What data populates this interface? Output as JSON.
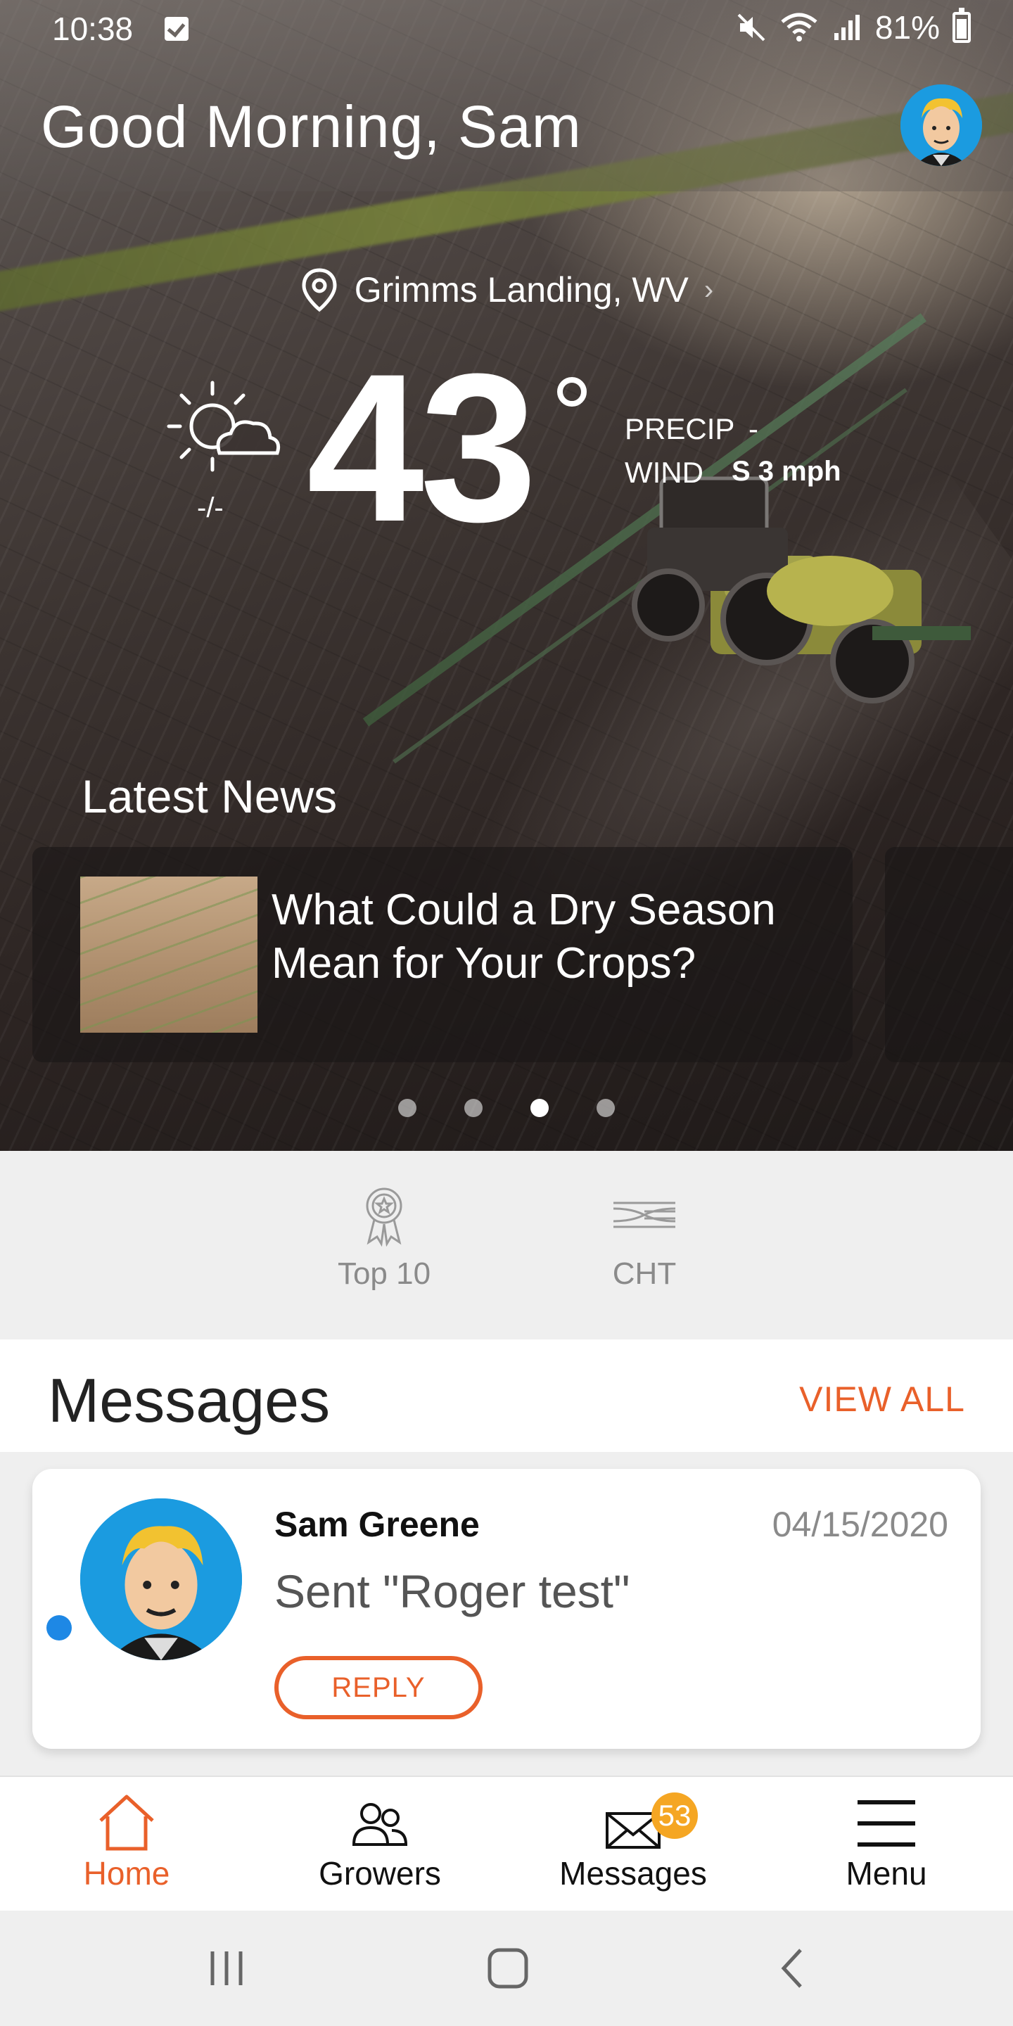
{
  "status_bar": {
    "time": "10:38",
    "battery": "81%"
  },
  "header": {
    "greeting": "Good Morning, Sam"
  },
  "weather": {
    "location": "Grimms Landing, WV",
    "temperature": "43",
    "hi_lo": "-/-",
    "precip_label": "PRECIP",
    "precip_value": "-",
    "wind_label": "WIND",
    "wind_value": "S 3 mph",
    "condition_icon": "partly-cloudy-icon"
  },
  "news": {
    "heading": "Latest News",
    "items": [
      {
        "title": "What Could a Dry Season Mean for Your Crops?"
      }
    ],
    "page_count": 4,
    "active_page": 3
  },
  "quick_links": [
    {
      "label": "Top 10",
      "icon": "award-ribbon-icon"
    },
    {
      "label": "CHT",
      "icon": "cht-logo-icon"
    }
  ],
  "messages": {
    "title": "Messages",
    "view_all": "VIEW ALL",
    "items": [
      {
        "sender": "Sam Greene",
        "date": "04/15/2020",
        "body": "Sent \"Roger test\"",
        "reply_label": "REPLY",
        "unread": true
      }
    ]
  },
  "bottom_nav": {
    "items": [
      {
        "label": "Home",
        "icon": "home-icon",
        "active": true
      },
      {
        "label": "Growers",
        "icon": "growers-icon",
        "active": false
      },
      {
        "label": "Messages",
        "icon": "envelope-icon",
        "active": false,
        "badge": "53"
      },
      {
        "label": "Menu",
        "icon": "hamburger-menu-icon",
        "active": false
      }
    ]
  },
  "colors": {
    "accent": "#e9602a",
    "badge": "#f5a623",
    "unread_dot": "#1e88e5",
    "avatar_bg": "#1b9be0"
  }
}
